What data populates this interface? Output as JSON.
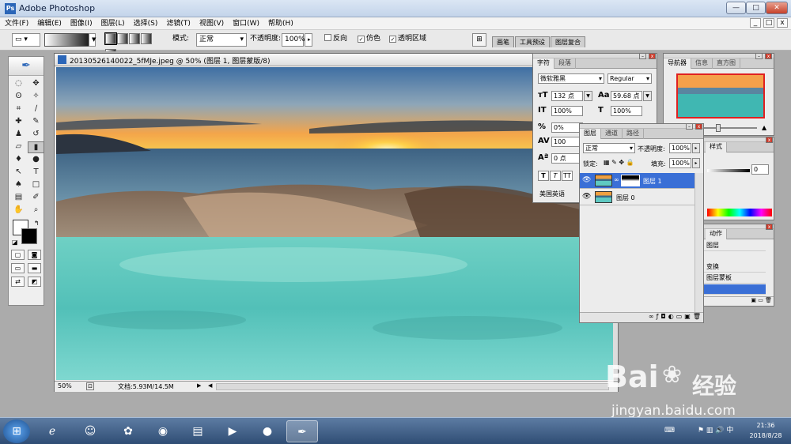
{
  "app": {
    "logo": "Ps",
    "title": "Adobe Photoshop",
    "window_controls": [
      "—",
      "□",
      "✕"
    ]
  },
  "menu": [
    "文件(F)",
    "编辑(E)",
    "图像(I)",
    "图层(L)",
    "选择(S)",
    "滤镜(T)",
    "视图(V)",
    "窗口(W)",
    "帮助(H)"
  ],
  "menu_right": [
    "_",
    "□",
    "x"
  ],
  "options": {
    "mode_label": "模式:",
    "mode_value": "正常",
    "opacity_label": "不透明度:",
    "opacity_value": "100%",
    "reverse_label": "反向",
    "dither_label": "仿色",
    "transparency_label": "透明区域",
    "well_tabs": [
      "画笔",
      "工具预设",
      "图层复合"
    ]
  },
  "document": {
    "title": "20130526140022_5fMJe.jpeg @ 50% (图层 1, 图层蒙版/8)",
    "zoom": "50%",
    "info": "文档:5.93M/14.5M"
  },
  "character": {
    "tabs": [
      "字符",
      "段落"
    ],
    "font_family": "微软雅黑",
    "font_style": "Regular",
    "font_size": "132 点",
    "leading": "59.68 点",
    "vertical_scale": "100%",
    "horizontal_scale": "100%",
    "kerning": "0%",
    "tracking": "100",
    "baseline": "0 点",
    "language": "美国英语",
    "format_buttons": [
      "T",
      "T",
      "TT"
    ]
  },
  "layers": {
    "tabs": [
      "图层",
      "通道",
      "路径"
    ],
    "blend_mode": "正常",
    "opacity_label": "不透明度:",
    "opacity_value": "100%",
    "lock_label": "锁定:",
    "fill_label": "填充:",
    "fill_value": "100%",
    "items": [
      {
        "name": "图层 1",
        "selected": true,
        "has_mask": true
      },
      {
        "name": "图层 0",
        "selected": false,
        "has_mask": false
      }
    ],
    "footer_icons": [
      "∞",
      "ƒ",
      "◘",
      "◐",
      "▭",
      "▣",
      "🗑"
    ]
  },
  "navigator": {
    "tabs": [
      "导航器",
      "信息",
      "直方图"
    ]
  },
  "color": {
    "tab": "样式",
    "value": "0"
  },
  "actions": {
    "tab": "动作",
    "items": [
      "图层",
      "变换",
      "图层蒙板",
      ""
    ]
  },
  "taskbar": {
    "apps": [
      "IE",
      "QQ",
      "影音",
      "Firefox",
      "资源管理器",
      "媒体",
      "录制",
      "Photoshop"
    ],
    "time": "21:36",
    "date": "2018/8/28"
  },
  "watermark": {
    "logo": "Bai",
    "logo2": "经验",
    "url": "jingyan.baidu.com"
  },
  "colors": {
    "accent": "#3a6fd6",
    "taskbar": "#2f4d74"
  }
}
